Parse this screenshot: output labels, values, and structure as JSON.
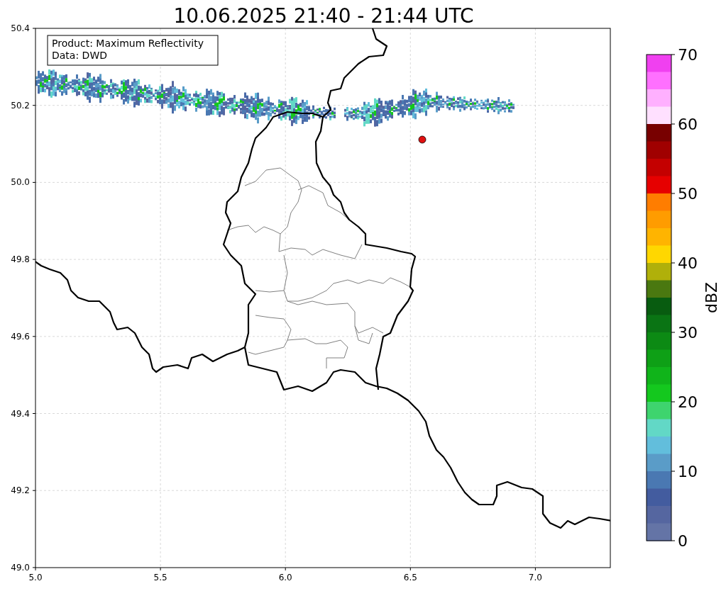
{
  "title": "10.06.2025 21:40 - 21:44 UTC",
  "info_box": [
    "Product: Maximum Reflectivity",
    "Data: DWD"
  ],
  "map": {
    "x_ticks": [
      "5.0",
      "5.5",
      "6.0",
      "6.5",
      "7.0"
    ],
    "y_ticks": [
      "50.4",
      "50.2",
      "50.0",
      "49.8",
      "49.6",
      "49.4",
      "49.2",
      "49.0"
    ]
  },
  "colorbar": {
    "label": "dBZ",
    "ticks": [
      "70",
      "60",
      "50",
      "40",
      "30",
      "20",
      "10",
      "0"
    ],
    "segments": [
      {
        "color": "#f040f0"
      },
      {
        "color": "#ff70ff"
      },
      {
        "color": "#ffb0ff"
      },
      {
        "color": "#ffe0ff"
      },
      {
        "color": "#780000"
      },
      {
        "color": "#a00000"
      },
      {
        "color": "#c40000"
      },
      {
        "color": "#e60000"
      },
      {
        "color": "#ff7d00"
      },
      {
        "color": "#ff9c00"
      },
      {
        "color": "#ffb400"
      },
      {
        "color": "#ffd700"
      },
      {
        "color": "#b0b00a"
      },
      {
        "color": "#4a7810"
      },
      {
        "color": "#085c10"
      },
      {
        "color": "#0a7414"
      },
      {
        "color": "#0c8a14"
      },
      {
        "color": "#0ea016"
      },
      {
        "color": "#10b41a"
      },
      {
        "color": "#14c81e"
      },
      {
        "color": "#3ed46e"
      },
      {
        "color": "#62d8c6"
      },
      {
        "color": "#62bedc"
      },
      {
        "color": "#5a9cc8"
      },
      {
        "color": "#4a78b2"
      },
      {
        "color": "#435c9f"
      },
      {
        "color": "#5566a0"
      },
      {
        "color": "#6474a6"
      }
    ]
  }
}
